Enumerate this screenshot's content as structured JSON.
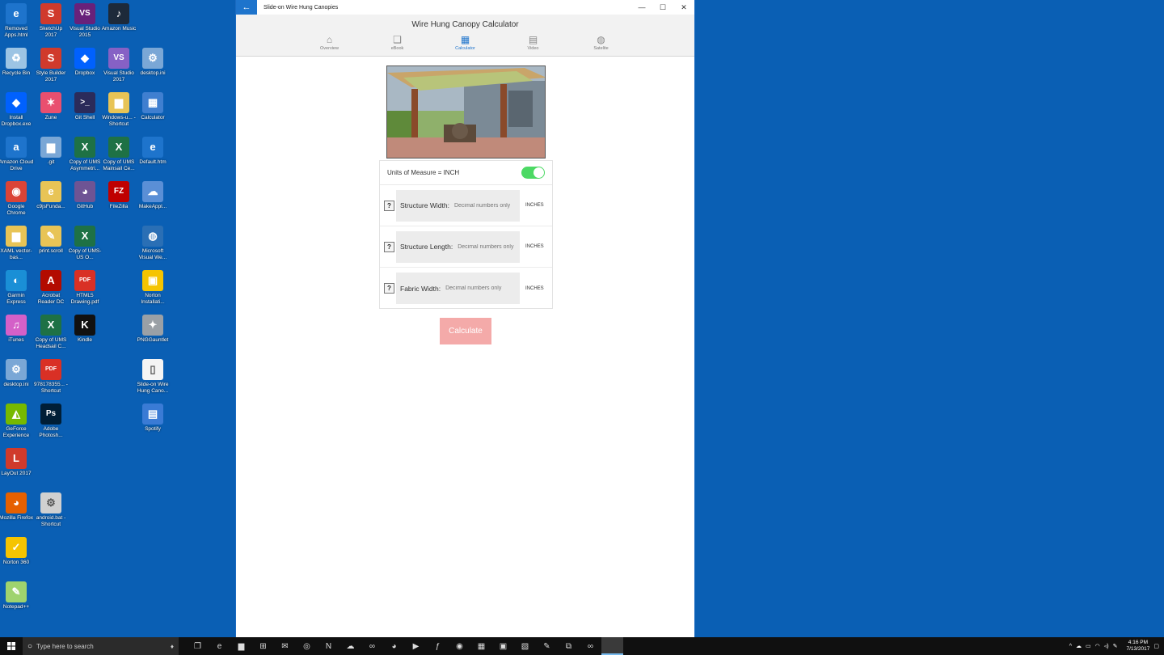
{
  "desktop_icons": [
    {
      "label": "Removed Apps.html",
      "icon": "edge-icon",
      "color": "#1e74cc",
      "glyph": "e"
    },
    {
      "label": "SketchUp 2017",
      "icon": "sketchup-icon",
      "color": "#d03a2c",
      "glyph": "S"
    },
    {
      "label": "Visual Studio 2015",
      "icon": "visual-studio-icon",
      "color": "#68217a",
      "glyph": "VS"
    },
    {
      "label": "Amazon Music",
      "icon": "amazon-music-icon",
      "color": "#1d2a3a",
      "glyph": "♪"
    },
    {
      "label": "Recycle Bin",
      "icon": "recycle-bin-icon",
      "color": "#9cc4e4",
      "glyph": "♻"
    },
    {
      "label": "Style Builder 2017",
      "icon": "style-builder-icon",
      "color": "#d03a2c",
      "glyph": "S"
    },
    {
      "label": "Dropbox",
      "icon": "dropbox-icon",
      "color": "#0061fe",
      "glyph": "◆"
    },
    {
      "label": "Visual Studio 2017",
      "icon": "visual-studio-icon",
      "color": "#8661c5",
      "glyph": "VS"
    },
    {
      "label": "desktop.ini",
      "icon": "settings-file-icon",
      "color": "#7aa7d6",
      "glyph": "⚙"
    },
    {
      "label": "Install Dropbox.exe",
      "icon": "dropbox-icon",
      "color": "#0061fe",
      "glyph": "◆"
    },
    {
      "label": "Zune",
      "icon": "zune-icon",
      "color": "#e94f6f",
      "glyph": "✶"
    },
    {
      "label": "Git Shell",
      "icon": "git-shell-icon",
      "color": "#2b2b5a",
      "glyph": ">_"
    },
    {
      "label": "Windows-u... - Shortcut",
      "icon": "folder-icon",
      "color": "#e8c456",
      "glyph": "▆"
    },
    {
      "label": "Calculator",
      "icon": "calculator-icon",
      "color": "#3f7fd0",
      "glyph": "▦"
    },
    {
      "label": "Amazon Cloud Drive",
      "icon": "amazon-icon",
      "color": "#1e74cc",
      "glyph": "a"
    },
    {
      "label": ".git",
      "icon": "folder-icon",
      "color": "#7aa7d6",
      "glyph": "▆"
    },
    {
      "label": "Copy of UMS Asymmetri...",
      "icon": "excel-icon",
      "color": "#1e7145",
      "glyph": "X"
    },
    {
      "label": "Copy of UMS Mainsail Ce...",
      "icon": "excel-icon",
      "color": "#1e7145",
      "glyph": "X"
    },
    {
      "label": "Default.htm",
      "icon": "edge-icon",
      "color": "#1e74cc",
      "glyph": "e"
    },
    {
      "label": "Google Chrome",
      "icon": "chrome-icon",
      "color": "#db4437",
      "glyph": "◉"
    },
    {
      "label": "c9jsFunda...",
      "icon": "edge-file-icon",
      "color": "#e8c456",
      "glyph": "e"
    },
    {
      "label": "GitHub",
      "icon": "github-icon",
      "color": "#6e5494",
      "glyph": "◕"
    },
    {
      "label": "FileZilla",
      "icon": "filezilla-icon",
      "color": "#bf0000",
      "glyph": "FZ"
    },
    {
      "label": "MakeAppl...",
      "icon": "makeappx-icon",
      "color": "#5a8fd6",
      "glyph": "☁"
    },
    {
      "label": "XAML vector-bas...",
      "icon": "folder-icon",
      "color": "#e8c456",
      "glyph": "▆"
    },
    {
      "label": "print.scroll",
      "icon": "scroll-file-icon",
      "color": "#e8c456",
      "glyph": "✎"
    },
    {
      "label": "Copy of UMS-US O...",
      "icon": "excel-icon",
      "color": "#1e7145",
      "glyph": "X"
    },
    {
      "label": "Microsoft Visual We...",
      "icon": "visual-web-icon",
      "color": "#2a6fb5",
      "glyph": "◍"
    },
    {
      "label": "Garmin Express",
      "icon": "garmin-icon",
      "color": "#1a8fd6",
      "glyph": "◐"
    },
    {
      "label": "Acrobat Reader DC",
      "icon": "acrobat-icon",
      "color": "#b30b00",
      "glyph": "A"
    },
    {
      "label": "HTML5 Drawing.pdf",
      "icon": "pdf-icon",
      "color": "#d93025",
      "glyph": "PDF"
    },
    {
      "label": "Norton Installati...",
      "icon": "norton-installer-icon",
      "color": "#f5c400",
      "glyph": "▣"
    },
    {
      "label": "iTunes",
      "icon": "itunes-icon",
      "color": "#d460c8",
      "glyph": "♫"
    },
    {
      "label": "Copy of UMS Headsail C...",
      "icon": "excel-icon",
      "color": "#1e7145",
      "glyph": "X"
    },
    {
      "label": "Kindle",
      "icon": "kindle-icon",
      "color": "#111111",
      "glyph": "K"
    },
    {
      "label": "PNGGauntlet",
      "icon": "pnggauntlet-icon",
      "color": "#9aa0a6",
      "glyph": "✦"
    },
    {
      "label": "desktop.ini",
      "icon": "settings-file-icon",
      "color": "#7aa7d6",
      "glyph": "⚙"
    },
    {
      "label": "978178355... - Shortcut",
      "icon": "pdf-icon",
      "color": "#d93025",
      "glyph": "PDF"
    },
    {
      "label": "Slide-on Wire Hung Cano...",
      "icon": "file-icon",
      "color": "#f4f4f4",
      "glyph": "▯"
    },
    {
      "label": "GeForce Experience",
      "icon": "geforce-icon",
      "color": "#76b900",
      "glyph": "◭"
    },
    {
      "label": "Adobe Photosh...",
      "icon": "photoshop-icon",
      "color": "#001e36",
      "glyph": "Ps"
    },
    {
      "label": "Spotify",
      "icon": "spotify-icon",
      "color": "#3a7bd5",
      "glyph": "▤"
    },
    {
      "label": "LayOut 2017",
      "icon": "layout-icon",
      "color": "#d03a2c",
      "glyph": "L"
    },
    {
      "label": "Mozilla Firefox",
      "icon": "firefox-icon",
      "color": "#e66000",
      "glyph": "◕"
    },
    {
      "label": "android.bat - Shortcut",
      "icon": "bat-file-icon",
      "color": "#d0d0d0",
      "glyph": "⚙"
    },
    {
      "label": "Norton 360",
      "icon": "norton-icon",
      "color": "#f5c400",
      "glyph": "✓"
    },
    {
      "label": "Notepad++",
      "icon": "notepadpp-icon",
      "color": "#9fd36e",
      "glyph": "✎"
    }
  ],
  "window": {
    "title": "Slide-on Wire Hung Canopies",
    "back_glyph": "←",
    "minimize_glyph": "—",
    "maximize_glyph": "☐",
    "close_glyph": "✕"
  },
  "app": {
    "title": "Wire Hung Canopy Calculator",
    "nav": [
      {
        "label": "Overview",
        "icon": "home-icon",
        "glyph": "⌂"
      },
      {
        "label": "eBook",
        "icon": "book-icon",
        "glyph": "❑"
      },
      {
        "label": "Calculator",
        "icon": "calculator-icon",
        "glyph": "▦"
      },
      {
        "label": "Video",
        "icon": "film-icon",
        "glyph": "▤"
      },
      {
        "label": "Satelite",
        "icon": "globe-icon",
        "glyph": "◍"
      }
    ],
    "active_nav": "Calculator",
    "units_label": "Units of Measure = INCH",
    "units_toggle_on": true,
    "fields": [
      {
        "label": "Structure Width:",
        "placeholder": "Decimal numbers only",
        "unit": "INCHES",
        "help": "?"
      },
      {
        "label": "Structure Length:",
        "placeholder": "Decimal numbers only",
        "unit": "INCHES",
        "help": "?"
      },
      {
        "label": "Fabric Width:",
        "placeholder": "Decimal numbers only",
        "unit": "INCHES",
        "help": "?"
      }
    ],
    "calculate_label": "Calculate"
  },
  "taskbar": {
    "search_placeholder": "Type here to search",
    "time": "4:16 PM",
    "date": "7/13/2017",
    "pinned": [
      {
        "icon": "task-view-icon",
        "glyph": "❐"
      },
      {
        "icon": "edge-icon",
        "glyph": "e"
      },
      {
        "icon": "file-explorer-icon",
        "glyph": "▆"
      },
      {
        "icon": "store-icon",
        "glyph": "⊞"
      },
      {
        "icon": "mail-icon",
        "glyph": "✉"
      },
      {
        "icon": "groove-icon",
        "glyph": "◎"
      },
      {
        "icon": "onenote-icon",
        "glyph": "N"
      },
      {
        "icon": "cloud-app-icon",
        "glyph": "☁"
      },
      {
        "icon": "visual-studio-icon",
        "glyph": "∞"
      },
      {
        "icon": "firefox-icon",
        "glyph": "◕"
      },
      {
        "icon": "media-icon",
        "glyph": "▶"
      },
      {
        "icon": "function-app-icon",
        "glyph": "ƒ"
      },
      {
        "icon": "chrome-icon",
        "glyph": "◉"
      },
      {
        "icon": "calculator-icon",
        "glyph": "▦"
      },
      {
        "icon": "terminal-icon",
        "glyph": "▣"
      },
      {
        "icon": "photo-app-icon",
        "glyph": "▧"
      },
      {
        "icon": "notes-app-icon",
        "glyph": "✎"
      },
      {
        "icon": "blend-icon",
        "glyph": "⧉"
      },
      {
        "icon": "visual-studio-2017-icon",
        "glyph": "∞"
      },
      {
        "icon": "active-app-icon",
        "glyph": " "
      }
    ],
    "tray": [
      {
        "icon": "chevron-up-icon",
        "glyph": "^"
      },
      {
        "icon": "onedrive-icon",
        "glyph": "☁"
      },
      {
        "icon": "battery-icon",
        "glyph": "▭"
      },
      {
        "icon": "wifi-icon",
        "glyph": "◠"
      },
      {
        "icon": "volume-icon",
        "glyph": "◃)"
      },
      {
        "icon": "pen-icon",
        "glyph": "✎"
      }
    ],
    "notification_glyph": "▢"
  }
}
